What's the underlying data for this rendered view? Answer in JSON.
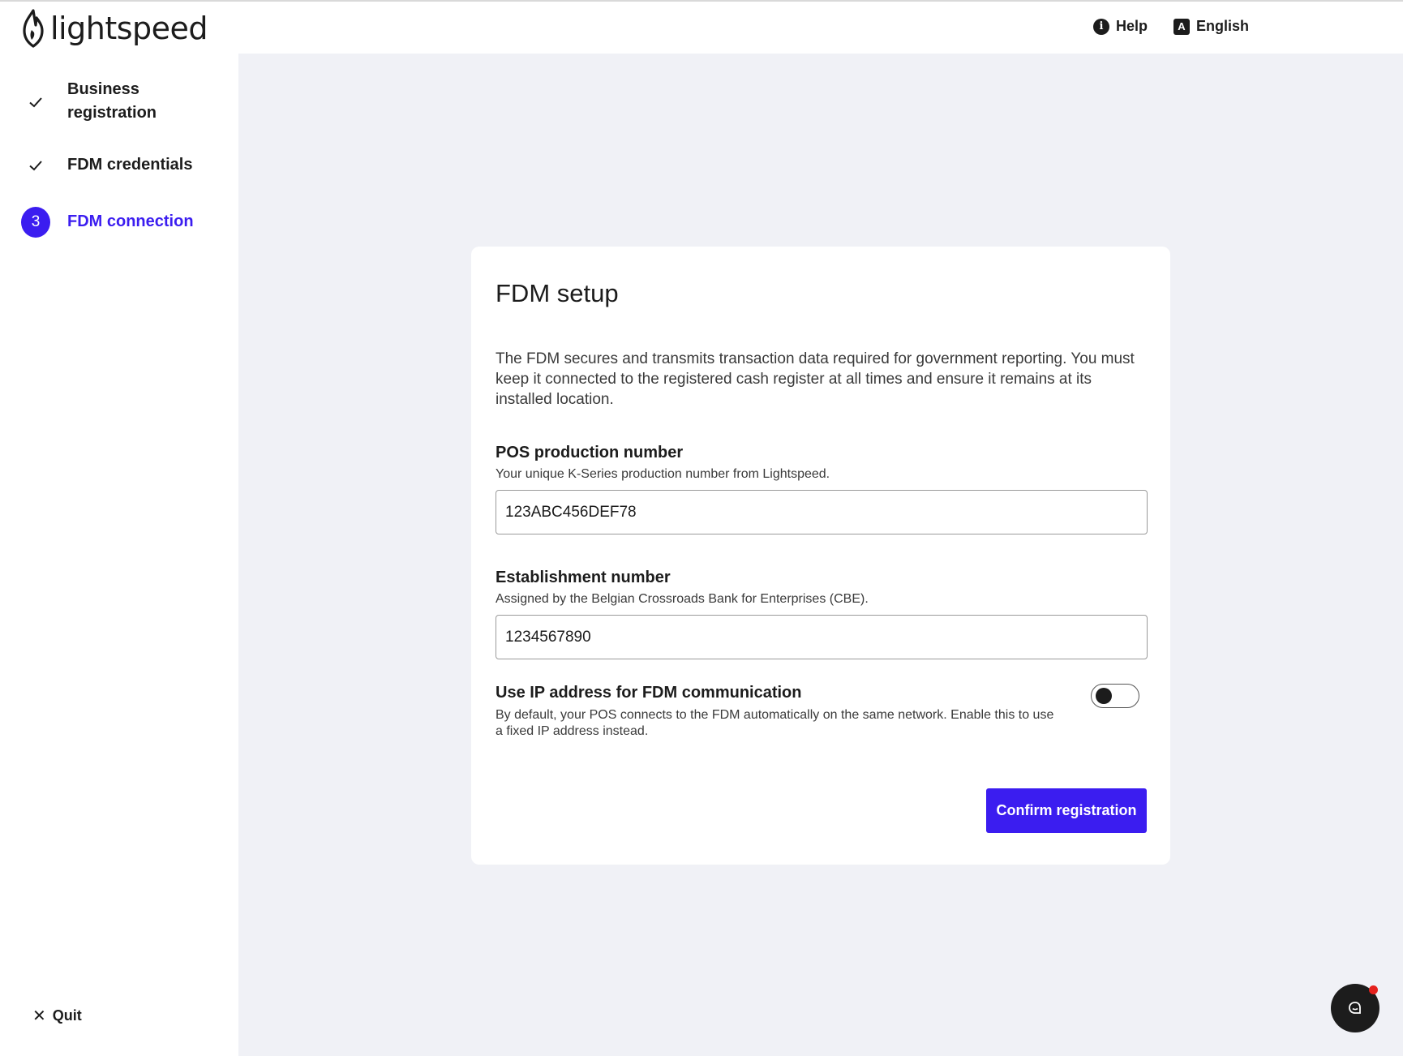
{
  "header": {
    "brand": "lightspeed",
    "help_label": "Help",
    "language_label": "English",
    "help_icon_glyph": "i",
    "language_icon_glyph": "A"
  },
  "sidebar": {
    "steps": [
      {
        "label": "Business registration",
        "state": "completed"
      },
      {
        "label": "FDM credentials",
        "state": "completed"
      },
      {
        "label": "FDM connection",
        "state": "active",
        "number": "3"
      }
    ],
    "quit_label": "Quit"
  },
  "card": {
    "title": "FDM setup",
    "description": "The FDM secures and transmits transaction data required for government reporting. You must keep it connected to the registered cash register at all times and ensure it remains at its installed location.",
    "pos_field": {
      "label": "POS production number",
      "help": "Your unique K-Series production number from Lightspeed.",
      "value": "123ABC456DEF78"
    },
    "establishment_field": {
      "label": "Establishment number",
      "help": "Assigned by the Belgian Crossroads Bank for Enterprises (CBE).",
      "value": "1234567890"
    },
    "ip_toggle": {
      "label": "Use IP address for FDM communication",
      "help": "By default, your POS connects to the FDM automatically on the same network. Enable this to use a fixed IP address instead.",
      "enabled": false
    },
    "confirm_label": "Confirm registration"
  },
  "colors": {
    "accent": "#3b1df0",
    "background": "#f0f1f6",
    "notification_dot": "#e5211d"
  }
}
